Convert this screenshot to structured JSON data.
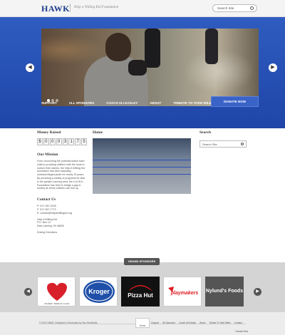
{
  "header": {
    "logo": "HAWK",
    "tagline": "Help a Willing Kid Foundation",
    "search_placeholder": "Search Site"
  },
  "nav": {
    "items": [
      "Support",
      "All Sponsors",
      "Coach Ali Easley",
      "About",
      "Tribute to Todd Wiles",
      "Contact"
    ],
    "donate": "Donate Now"
  },
  "money": {
    "heading": "Money Raised",
    "digits": [
      "$",
      "0",
      "0",
      "0",
      "3",
      "1",
      "7",
      "5"
    ]
  },
  "mission": {
    "heading": "Our Mission",
    "text": "From uncovering the potential within each child to providing children with the tools to nurture their talents, the Help A Willing Kid foundation has been assisting underprivileged youth for nearly 15 years. By providing a variety of programs for kids in the greater Lansing area, the H.A.W.K. Foundation has tried to bridge a gap in society as these children can rise up."
  },
  "contact": {
    "heading": "Contact Us",
    "lines": [
      "P: 517-367-0150",
      "F: 517-367-7773",
      "E: contact@helpawillingkid.org",
      "",
      "Help A Willing Kid",
      "P.O. Box 13",
      "East Lansing, MI 48826",
      "",
      "Driving Directions"
    ]
  },
  "home": {
    "heading": "Home"
  },
  "sidebar": {
    "search_heading": "Search",
    "search_placeholder": "Search Site"
  },
  "sponsors": {
    "tab_label": "Grand Sponsors",
    "items": [
      {
        "name": "Pediatric Medical Center",
        "icon": "heart-logo"
      },
      {
        "name": "Kroger",
        "icon": "kroger-logo"
      },
      {
        "name": "Pizza Hut",
        "icon": "pizza-hut-logo"
      },
      {
        "name": "playmakers",
        "icon": "playmakers-logo"
      },
      {
        "name": "Nylund's Foods",
        "icon": "nylunds-logo"
      }
    ]
  },
  "footer": {
    "copyright": "© 2013 HAWK. Designed & Developed by Two Hat Media",
    "home": "Home",
    "links": [
      "Support",
      "All Sponsors",
      "Coach Ali Easley",
      "About",
      "Tribute To Todd Wiles",
      "Contact"
    ],
    "donate": "Donate Now"
  },
  "colors": {
    "brand_blue": "#2a52b8",
    "donate_blue": "#3a63c8"
  }
}
